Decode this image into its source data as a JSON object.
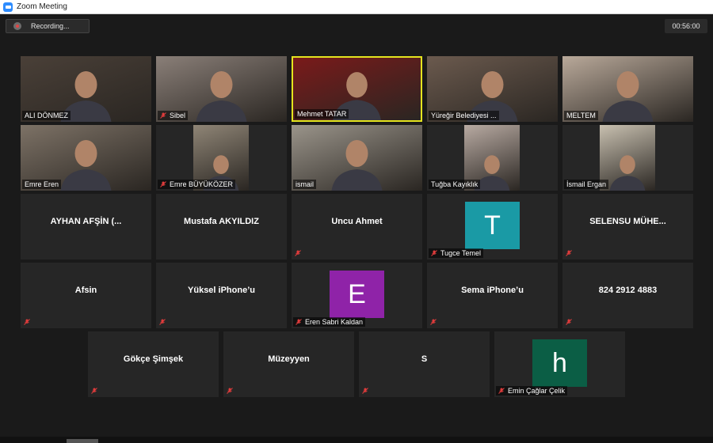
{
  "window": {
    "title": "Zoom Meeting"
  },
  "toolbar": {
    "recording_label": "Recording...",
    "timer": "00:56:00"
  },
  "participants": [
    {
      "name": "ALI DÖNMEZ",
      "video": true,
      "muted": false,
      "bg": "#4a4038"
    },
    {
      "name": "Sibel",
      "video": true,
      "muted": true,
      "bg": "#8a7f78"
    },
    {
      "name": "Mehmet TATAR",
      "video": true,
      "muted": false,
      "active": true,
      "bg": "#7a1a1a"
    },
    {
      "name": "Yüreğir Belediyesi ...",
      "video": true,
      "muted": false,
      "bg": "#6b5a4e"
    },
    {
      "name": "MELTEM",
      "video": true,
      "muted": false,
      "bg": "#b9a99a"
    },
    {
      "name": "Emre Eren",
      "video": true,
      "muted": false,
      "bg": "#7d7266"
    },
    {
      "name": "Emre BÜYÜKÖZER",
      "video": true,
      "muted": true,
      "bg": "#8f8576"
    },
    {
      "name": "ismail",
      "video": true,
      "muted": false,
      "bg": "#9a948a"
    },
    {
      "name": "Tuğba Kayıklık",
      "video": true,
      "muted": false,
      "bg": "#b8aaa2"
    },
    {
      "name": "İsmail Ergan",
      "video": true,
      "muted": false,
      "bg": "#c8c0b0"
    },
    {
      "name": "AYHAN AFŞİN (...",
      "video": false,
      "muted": false
    },
    {
      "name": "Mustafa AKYILDIZ",
      "video": false,
      "muted": false
    },
    {
      "name": "Uncu Ahmet",
      "video": false,
      "muted": true
    },
    {
      "name": "Tugce Temel",
      "video": false,
      "muted": true,
      "initial": "T",
      "avatar_color": "#1a9aa5"
    },
    {
      "name": "SELENSU  MÜHE...",
      "video": false,
      "muted": true
    },
    {
      "name": "Afsin",
      "video": false,
      "muted": true
    },
    {
      "name": "Yüksel iPhone’u",
      "video": false,
      "muted": true
    },
    {
      "name": "Eren Sabri Kaldan",
      "video": false,
      "muted": true,
      "initial": "E",
      "avatar_color": "#8f23a8"
    },
    {
      "name": "Sema iPhone’u",
      "video": false,
      "muted": true
    },
    {
      "name": "824 2912 4883",
      "video": false,
      "muted": true
    },
    {
      "name": "Gökçe Şimşek",
      "video": false,
      "muted": true
    },
    {
      "name": "Müzeyyen",
      "video": false,
      "muted": true
    },
    {
      "name": "S",
      "video": false,
      "muted": true
    },
    {
      "name": "Emin Çağlar Çelik",
      "video": false,
      "muted": true,
      "initial": "h",
      "avatar_color": "#0b5e45"
    }
  ],
  "colors": {
    "mute_icon": "#e03c3c",
    "active_speaker": "#e4e41f",
    "background": "#1a1a1a",
    "tile": "#262626"
  }
}
